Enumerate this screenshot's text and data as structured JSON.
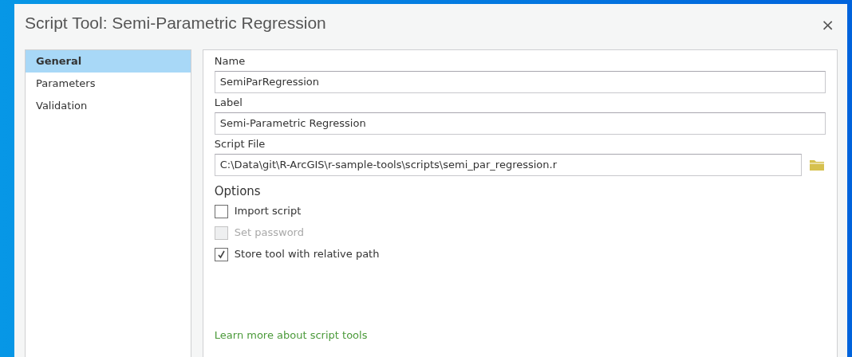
{
  "window": {
    "title": "Script Tool: Semi-Parametric Regression",
    "close": "×"
  },
  "sidebar": {
    "items": [
      {
        "label": "General",
        "selected": true
      },
      {
        "label": "Parameters",
        "selected": false
      },
      {
        "label": "Validation",
        "selected": false
      }
    ]
  },
  "fields": [
    {
      "label": "Name",
      "value": "SemiParRegression",
      "kind": "text"
    },
    {
      "label": "Label",
      "value": "Semi-Parametric Regression",
      "kind": "text"
    },
    {
      "label": "Script File",
      "value": "C:\\Data\\git\\R-ArcGIS\\r-sample-tools\\scripts\\semi_par_regression.r",
      "kind": "file"
    }
  ],
  "options": {
    "heading": "Options",
    "items": [
      {
        "label": "Import script",
        "checked": false,
        "disabled": false
      },
      {
        "label": "Set password",
        "checked": false,
        "disabled": true
      },
      {
        "label": "Store tool with relative path",
        "checked": true,
        "disabled": false
      }
    ]
  },
  "link": "Learn more about script tools"
}
